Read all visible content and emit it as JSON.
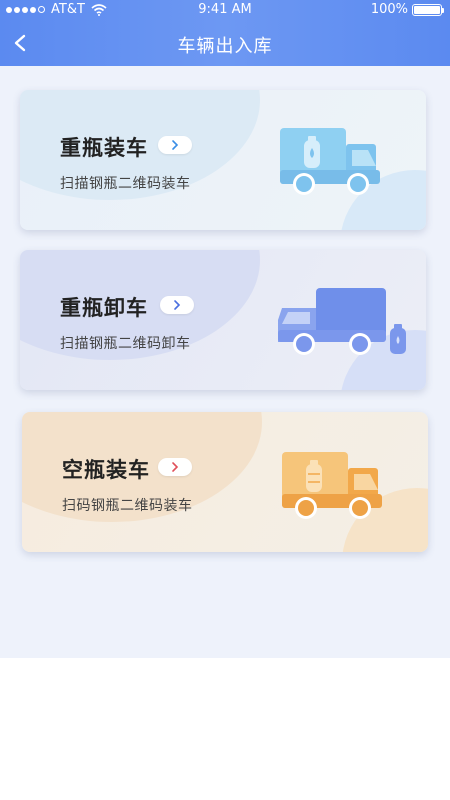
{
  "status_bar": {
    "carrier": "AT&T",
    "time": "9:41 AM",
    "battery": "100%"
  },
  "nav": {
    "title": "车辆出入库",
    "back_icon": "chevron-left-icon"
  },
  "colors": {
    "header": "#5b8af0",
    "blue_accent": "#3a8ee6",
    "red_accent": "#e0505a",
    "blue_truck": "#7ec3ee",
    "indigo_truck": "#6f8fea",
    "orange_truck": "#f2a84a"
  },
  "cards": [
    {
      "title": "重瓶装车",
      "subtitle": "扫描钢瓶二维码装车",
      "chevron_icon": "chevron-right-icon",
      "truck_icon": "truck-with-gas-cylinder-icon"
    },
    {
      "title": "重瓶卸车",
      "subtitle": "扫描钢瓶二维码卸车",
      "chevron_icon": "chevron-right-icon",
      "truck_icon": "truck-unloading-gas-cylinder-icon"
    },
    {
      "title": "空瓶装车",
      "subtitle": "扫码钢瓶二维码装车",
      "chevron_icon": "chevron-right-icon",
      "truck_icon": "truck-with-empty-cylinder-icon"
    }
  ]
}
